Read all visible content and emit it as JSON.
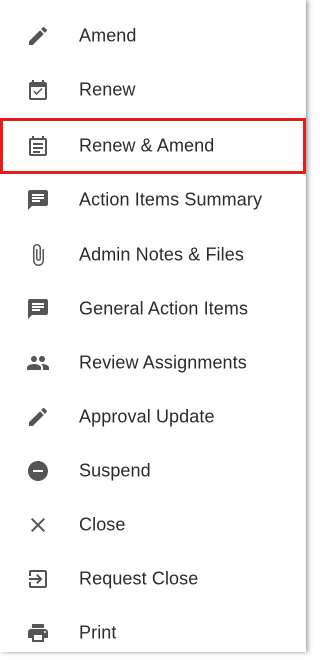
{
  "menu": {
    "highlight_color": "#e11d1d",
    "icon_color": "#555555",
    "items": [
      {
        "label": "Amend",
        "icon": "pencil-icon"
      },
      {
        "label": "Renew",
        "icon": "calendar-check-icon"
      },
      {
        "label": "Renew & Amend",
        "icon": "calendar-list-icon",
        "highlighted": true
      },
      {
        "label": "Action Items Summary",
        "icon": "comment-icon"
      },
      {
        "label": "Admin Notes & Files",
        "icon": "paperclip-icon"
      },
      {
        "label": "General Action Items",
        "icon": "comment-icon"
      },
      {
        "label": "Review Assignments",
        "icon": "people-icon"
      },
      {
        "label": "Approval Update",
        "icon": "pencil-icon"
      },
      {
        "label": "Suspend",
        "icon": "minus-circle-icon"
      },
      {
        "label": "Close",
        "icon": "close-icon"
      },
      {
        "label": "Request Close",
        "icon": "exit-icon"
      },
      {
        "label": "Print",
        "icon": "printer-icon"
      }
    ]
  }
}
